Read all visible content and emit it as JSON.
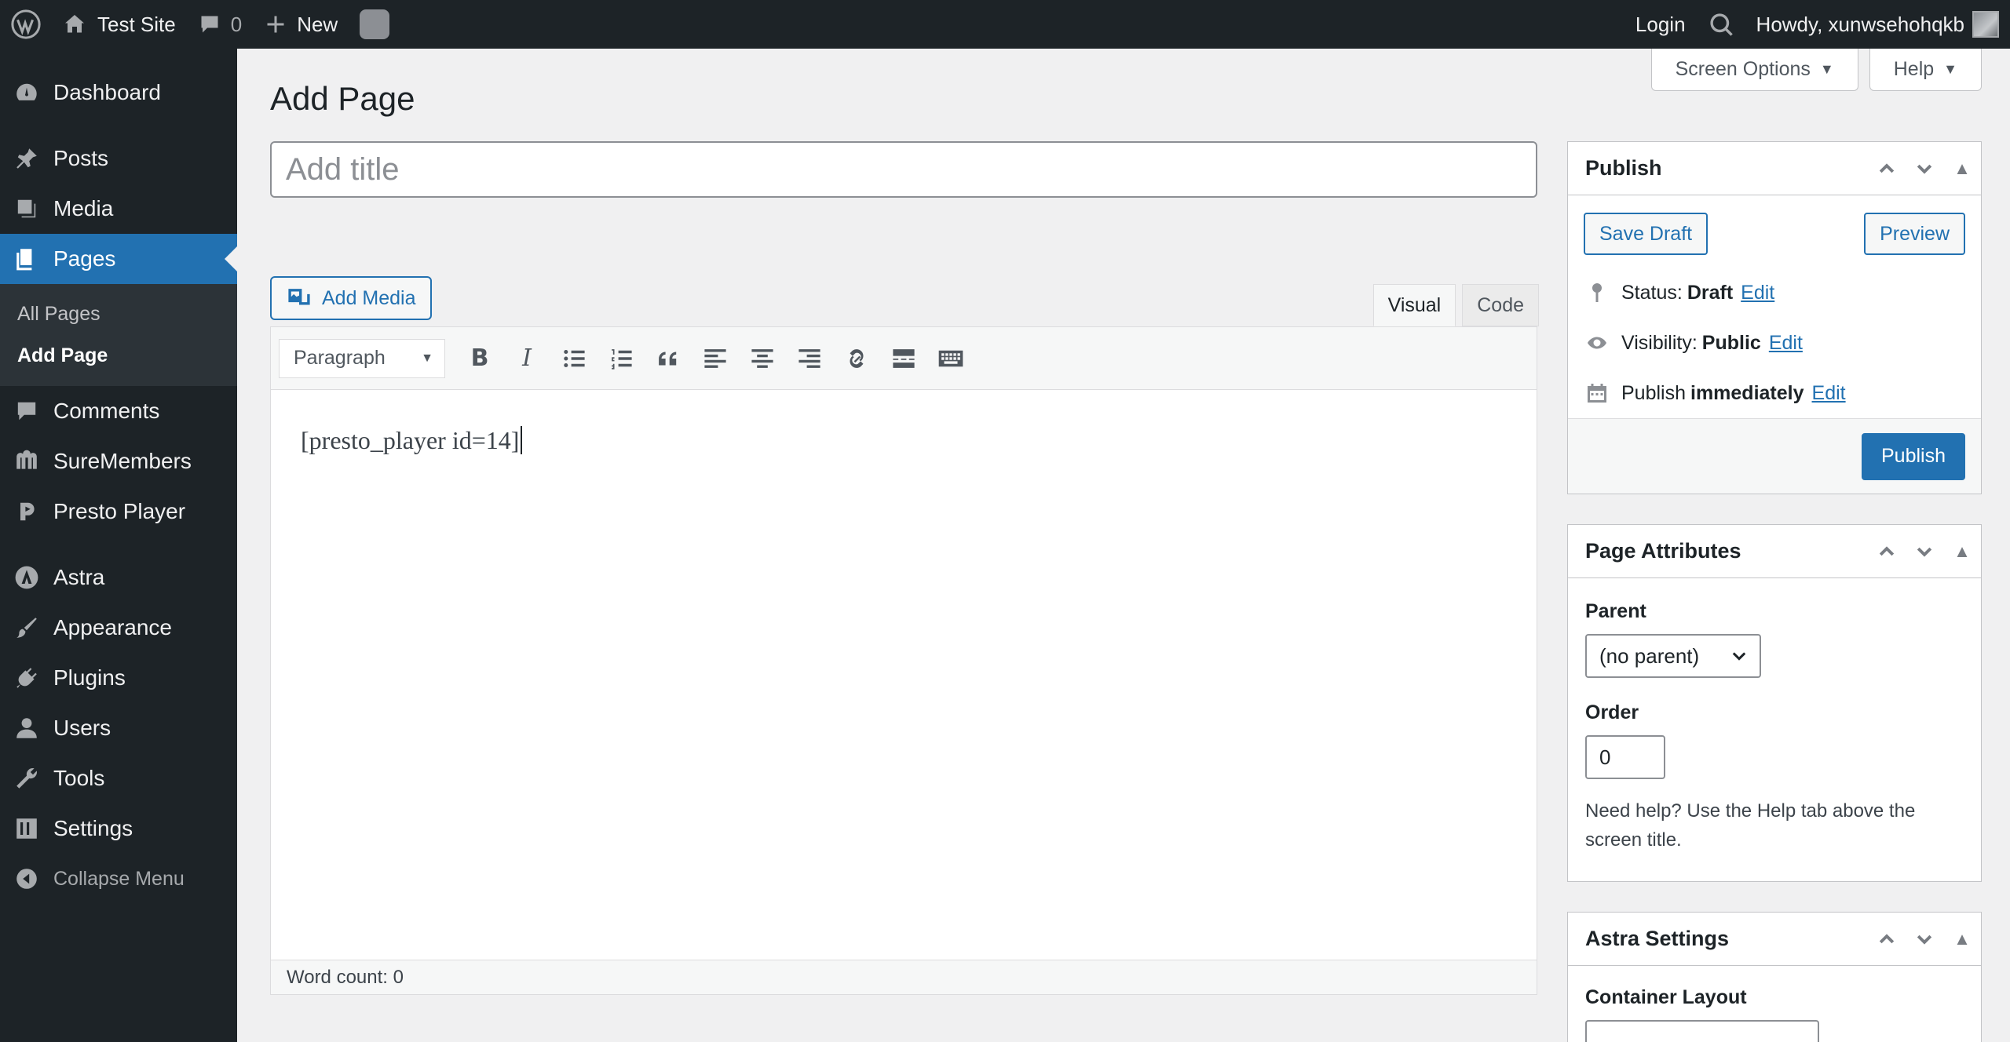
{
  "adminbar": {
    "site_name": "Test Site",
    "comments_count": "0",
    "new_label": "New",
    "login_label": "Login",
    "howdy": "Howdy, xunwsehohqkb"
  },
  "sidebar": {
    "items": [
      {
        "label": "Dashboard",
        "icon": "dashboard-icon"
      },
      {
        "label": "Posts",
        "icon": "pin-icon"
      },
      {
        "label": "Media",
        "icon": "media-icon"
      },
      {
        "label": "Pages",
        "icon": "pages-icon"
      },
      {
        "label": "Comments",
        "icon": "comment-icon"
      },
      {
        "label": "SureMembers",
        "icon": "suremembers-icon"
      },
      {
        "label": "Presto Player",
        "icon": "presto-icon"
      },
      {
        "label": "Astra",
        "icon": "astra-icon"
      },
      {
        "label": "Appearance",
        "icon": "brush-icon"
      },
      {
        "label": "Plugins",
        "icon": "plug-icon"
      },
      {
        "label": "Users",
        "icon": "user-icon"
      },
      {
        "label": "Tools",
        "icon": "wrench-icon"
      },
      {
        "label": "Settings",
        "icon": "sliders-icon"
      }
    ],
    "submenu": [
      "All Pages",
      "Add Page"
    ],
    "collapse_label": "Collapse Menu"
  },
  "screen_meta": {
    "screen_options": "Screen Options",
    "help": "Help"
  },
  "page": {
    "title": "Add Page",
    "title_placeholder": "Add title",
    "add_media": "Add Media",
    "tab_visual": "Visual",
    "tab_code": "Code",
    "format": "Paragraph",
    "content": "[presto_player id=14]",
    "word_count": "Word count: 0"
  },
  "publish": {
    "heading": "Publish",
    "save_draft": "Save Draft",
    "preview": "Preview",
    "status_label": "Status:",
    "status_value": "Draft",
    "visibility_label": "Visibility:",
    "visibility_value": "Public",
    "publish_label": "Publish",
    "publish_value": "immediately",
    "edit": "Edit",
    "publish_button": "Publish"
  },
  "page_attributes": {
    "heading": "Page Attributes",
    "parent_label": "Parent",
    "parent_value": "(no parent)",
    "order_label": "Order",
    "order_value": "0",
    "help": "Need help? Use the Help tab above the screen title."
  },
  "astra": {
    "heading": "Astra Settings",
    "container_layout": "Container Layout"
  },
  "colors": {
    "accent": "#2271b1",
    "adminbar": "#1d2327",
    "background": "#f0f0f1"
  }
}
